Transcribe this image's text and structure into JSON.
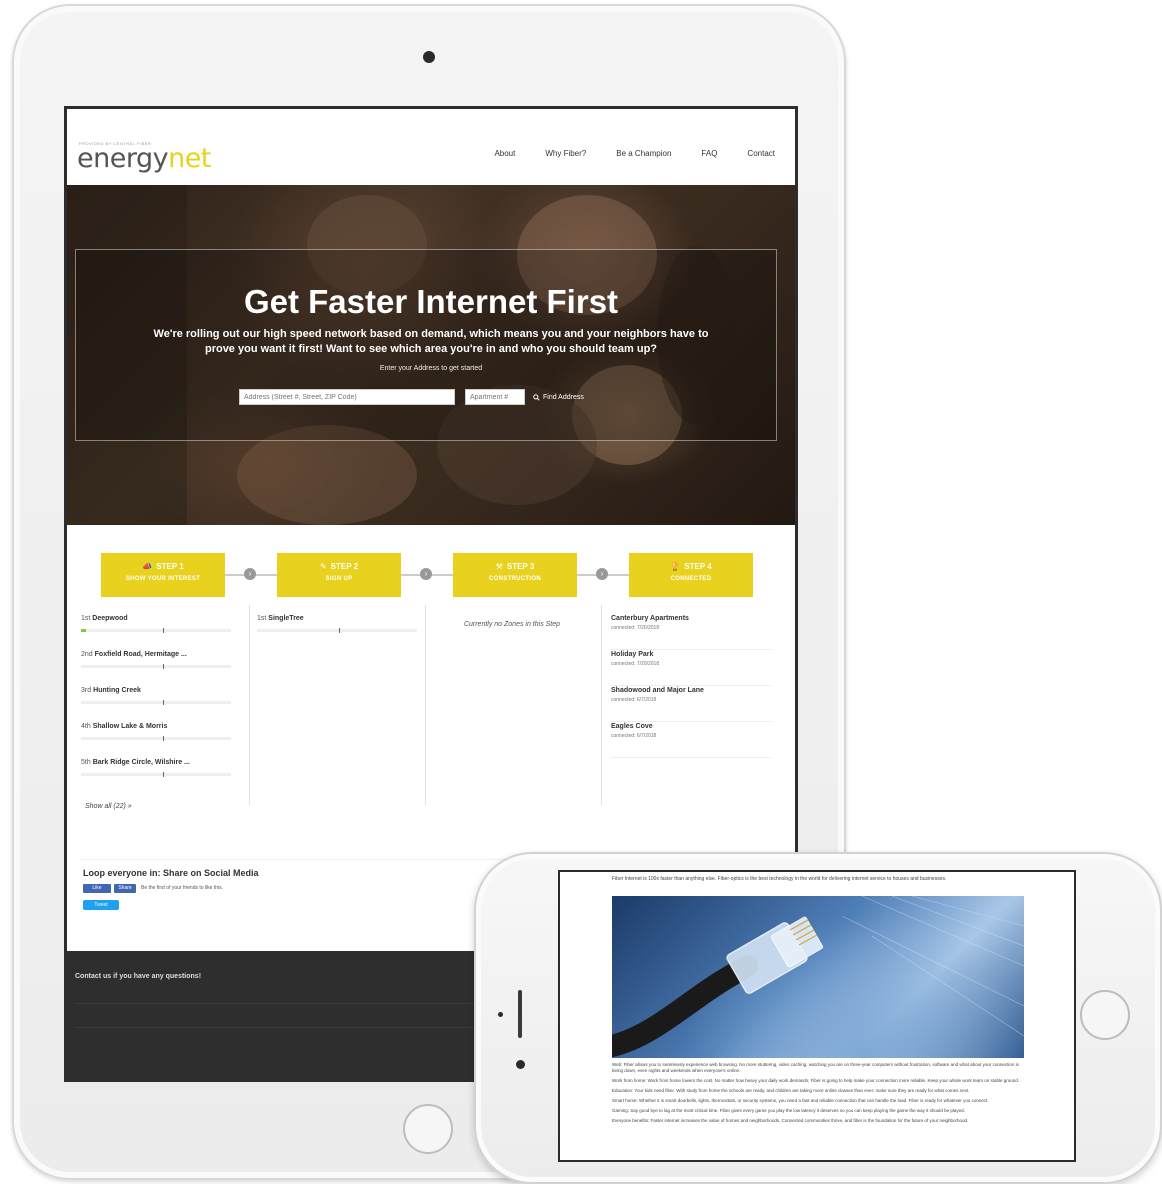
{
  "site": {
    "logo_tagline": "PROVIDED BY CENTRAL FIBER",
    "logo_main": "energy",
    "logo_accent": "net",
    "nav": [
      "About",
      "Why Fiber?",
      "Be a Champion",
      "FAQ",
      "Contact"
    ]
  },
  "hero": {
    "title": "Get Faster Internet First",
    "subtitle": "We're rolling out our high speed network based on demand, which means you and your neighbors have to prove you want it first! Want to see which area you're in and who you should team up?",
    "hint": "Enter your Address to get started",
    "address_placeholder": "Address (Street #, Street, ZIP Code)",
    "apartment_placeholder": "Apartment #",
    "find_label": "Find Address"
  },
  "steps": [
    {
      "title": "STEP 1",
      "subtitle": "SHOW YOUR INTEREST"
    },
    {
      "title": "STEP 2",
      "subtitle": "SIGN UP"
    },
    {
      "title": "STEP 3",
      "subtitle": "CONSTRUCTION"
    },
    {
      "title": "STEP 4",
      "subtitle": "CONNECTED"
    }
  ],
  "step1_zones": [
    {
      "rank": "1st",
      "name": "Deepwood",
      "progress": 0.03
    },
    {
      "rank": "2nd",
      "name": "Foxfield Road, Hermitage ...",
      "progress": 0
    },
    {
      "rank": "3rd",
      "name": "Hunting Creek",
      "progress": 0
    },
    {
      "rank": "4th",
      "name": "Shallow Lake & Morris",
      "progress": 0
    },
    {
      "rank": "5th",
      "name": "Bark Ridge Circle, Wilshire ...",
      "progress": 0
    }
  ],
  "step2_zones": [
    {
      "rank": "1st",
      "name": "SingleTree",
      "progress": 0
    }
  ],
  "step3_empty": "Currently no Zones in this Step",
  "step4_connected": [
    {
      "name": "Canterbury Apartments",
      "date": "connected: 7/20/2018"
    },
    {
      "name": "Holiday Park",
      "date": "connected: 7/20/2018"
    },
    {
      "name": "Shadowood and Major Lane",
      "date": "connected: 6/7/2018"
    },
    {
      "name": "Eagles Cove",
      "date": "connected: 6/7/2018"
    }
  ],
  "show_all": "Show all (22) »",
  "social": {
    "title": "Loop everyone in: Share on Social Media",
    "like": "Like",
    "share": "Share",
    "note": "Be the first of your friends to like this.",
    "tweet": "Tweet"
  },
  "footer": {
    "text": "Contact us if you have any questions!"
  },
  "phone": {
    "intro": "Fiber Internet is 100x faster than anything else. Fiber-optics is the best technology in the world for delivering internet service to houses and businesses.",
    "paragraphs": [
      "Web: Fiber allows you to seamlessly experience web browsing. No more stuttering, video caching, watching you are on three-year computers without frustration, software and what about your connection is being down, even nights and weekends when everyone's online.",
      "Work from home: Work from home lowers the cost. No matter how heavy your daily work demands, Fiber is going to help make your connection more reliable. Keep your whole work team on stable ground.",
      "Education: Your kids need fiber. With study from home the schools are ready, and children are taking more online classes than ever; make sure they are ready for what comes next.",
      "Smart home: Whether it is smart doorbells, lights, thermostats, or security systems, you need a fast and reliable connection that can handle the load. Fiber is ready for whatever you connect.",
      "Gaming: Say good bye to lag at the most critical time. Fiber gives every game you play the low latency it deserves so you can keep playing the game the way it should be played.",
      "Everyone benefits: Faster internet increases the value of homes and neighborhoods. Connected communities thrive, and fiber is the foundation for the future of your neighborhood."
    ]
  },
  "colors": {
    "brand_yellow": "#e8d21e",
    "footer_bg": "#2e2e2e",
    "facebook": "#4267b2",
    "twitter": "#1da1f2"
  }
}
